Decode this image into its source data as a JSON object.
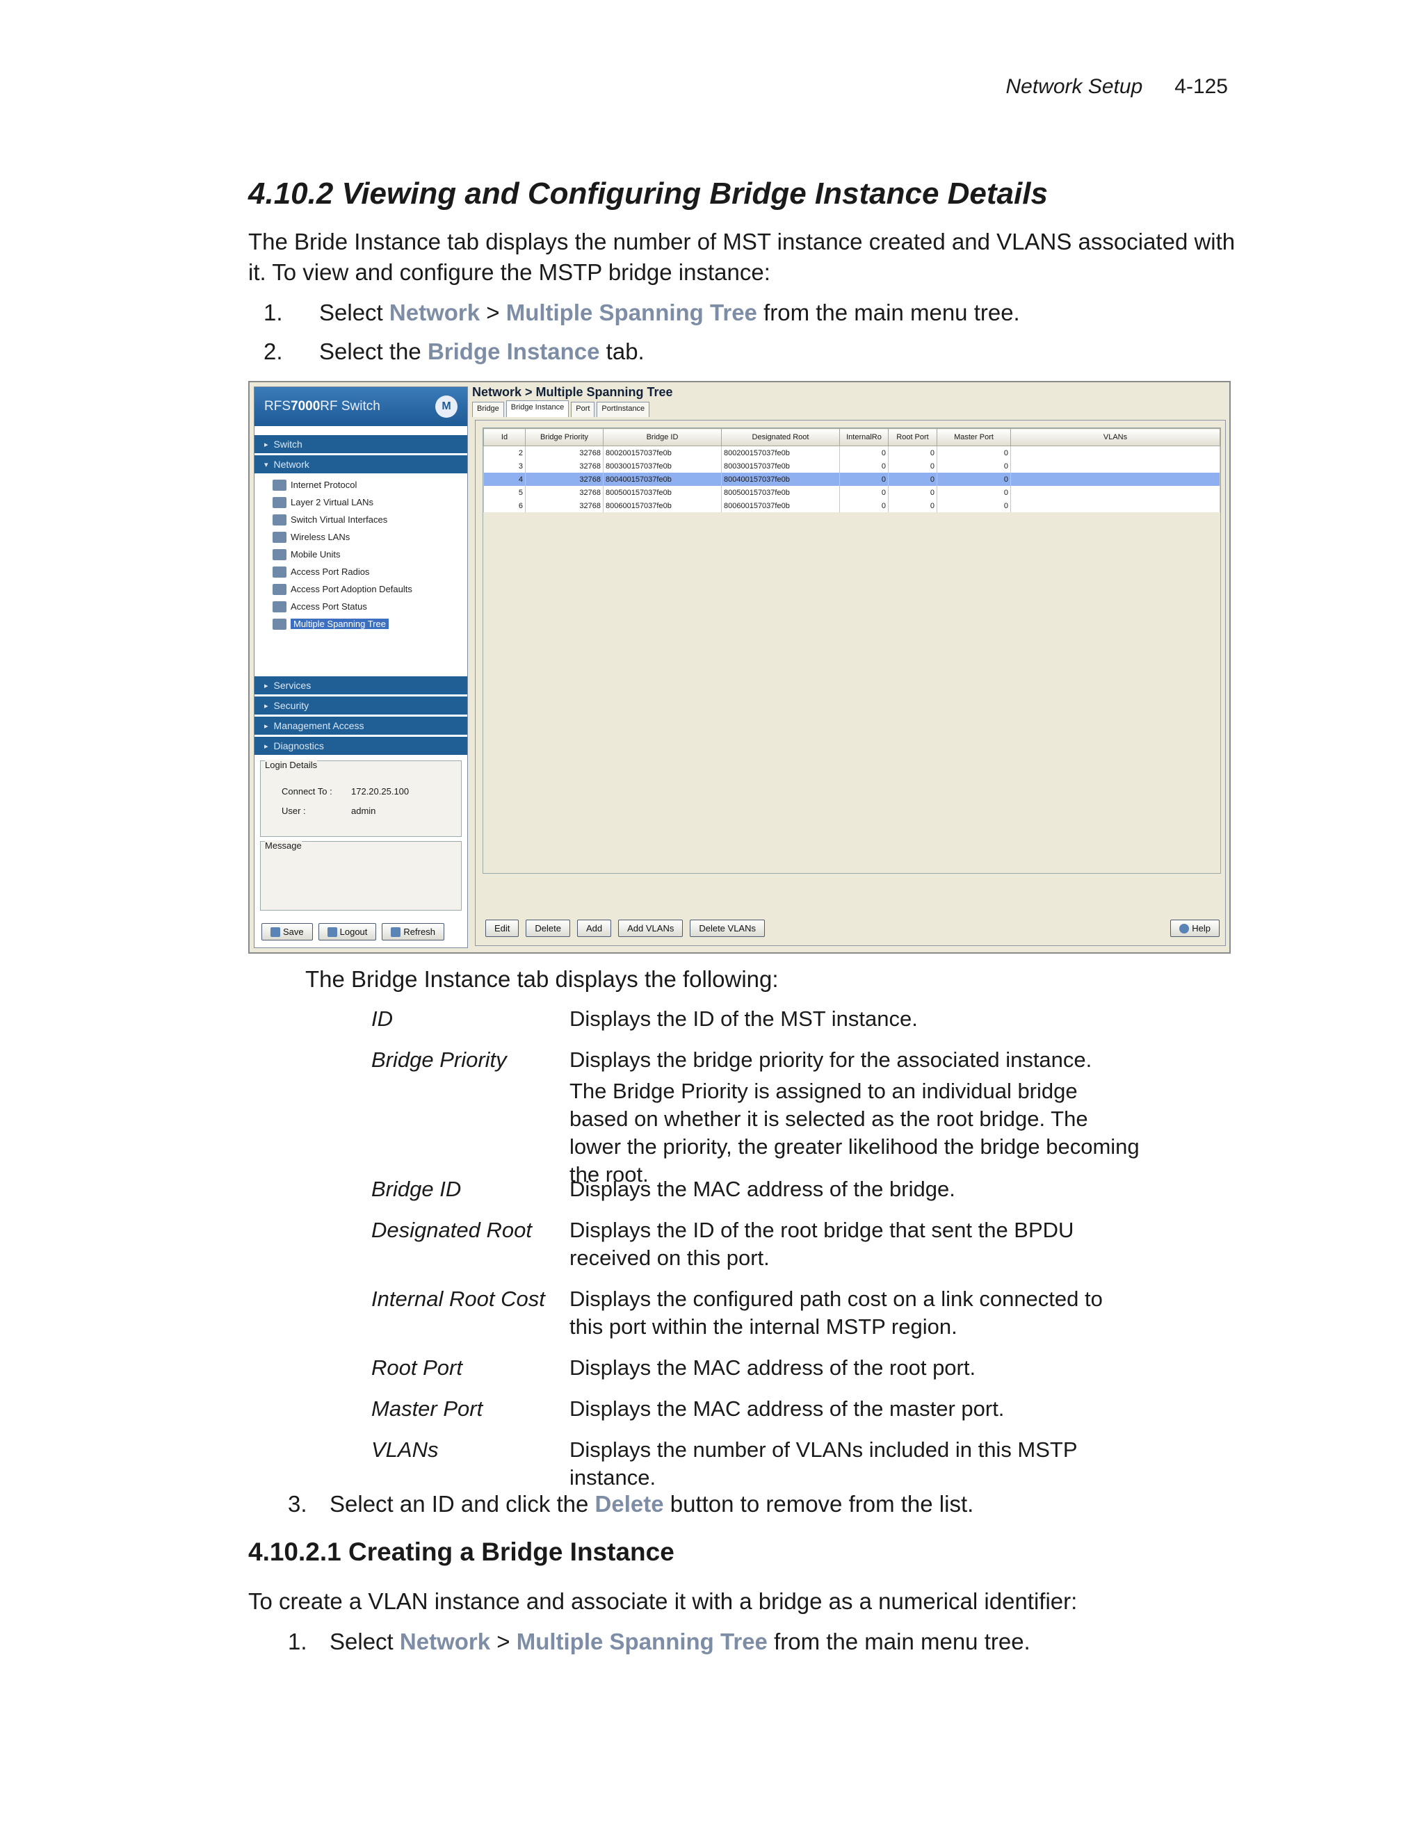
{
  "header": {
    "section": "Network Setup",
    "page": "4-125"
  },
  "title": "4.10.2 Viewing and Configuring Bridge Instance Details",
  "intro": "The Bride Instance tab displays the number of MST instance created and VLANS associated with it. To view and configure the MSTP bridge instance:",
  "steps_a": [
    {
      "num": "1.",
      "pre": "Select ",
      "k1": "Network",
      "mid": " > ",
      "k2": "Multiple Spanning Tree",
      "post": " from the main menu tree."
    },
    {
      "num": "2.",
      "pre": "Select the ",
      "k1": "Bridge Instance",
      "post": " tab."
    }
  ],
  "ui": {
    "brand_pre": "RFS",
    "brand_bold": "7000",
    "brand_post": " RF Switch",
    "logo": "M",
    "nav_top": [
      {
        "label": "Switch",
        "arrow": "▸"
      },
      {
        "label": "Network",
        "arrow": "▾"
      }
    ],
    "tree": [
      "Internet Protocol",
      "Layer 2 Virtual LANs",
      "Switch Virtual Interfaces",
      "Wireless LANs",
      "Mobile Units",
      "Access Port Radios",
      "Access Port Adoption Defaults",
      "Access Port Status",
      "Multiple Spanning Tree"
    ],
    "nav_bottom": [
      {
        "label": "Services",
        "arrow": "▸"
      },
      {
        "label": "Security",
        "arrow": "▸"
      },
      {
        "label": "Management Access",
        "arrow": "▸"
      },
      {
        "label": "Diagnostics",
        "arrow": "▸"
      }
    ],
    "login": {
      "caption": "Login Details",
      "connect_label": "Connect To :",
      "connect_value": "172.20.25.100",
      "user_label": "User :",
      "user_value": "admin"
    },
    "message_caption": "Message",
    "left_buttons": [
      "Save",
      "Logout",
      "Refresh"
    ],
    "right_title": "Network > Multiple Spanning Tree",
    "tabs": [
      "Bridge",
      "Bridge Instance",
      "Port",
      "PortInstance"
    ],
    "columns": [
      "Id",
      "Bridge Priority",
      "Bridge ID",
      "Designated Root",
      "InternalRo",
      "Root Port",
      "Master Port",
      "VLANs"
    ],
    "rows": [
      [
        "2",
        "32768",
        "800200157037fe0b",
        "800200157037fe0b",
        "0",
        "0",
        "0",
        ""
      ],
      [
        "3",
        "32768",
        "800300157037fe0b",
        "800300157037fe0b",
        "0",
        "0",
        "0",
        ""
      ],
      [
        "4",
        "32768",
        "800400157037fe0b",
        "800400157037fe0b",
        "0",
        "0",
        "0",
        ""
      ],
      [
        "5",
        "32768",
        "800500157037fe0b",
        "800500157037fe0b",
        "0",
        "0",
        "0",
        ""
      ],
      [
        "6",
        "32768",
        "800600157037fe0b",
        "800600157037fe0b",
        "0",
        "0",
        "0",
        ""
      ]
    ],
    "selected_row": 2,
    "bottom_buttons": [
      "Edit",
      "Delete",
      "Add",
      "Add VLANs",
      "Delete VLANs"
    ],
    "help": "Help"
  },
  "displays_intro": "The Bridge Instance tab displays the following:",
  "defs": [
    {
      "term": "ID",
      "def": [
        "Displays the ID of the MST instance."
      ]
    },
    {
      "term": "Bridge Priority",
      "def": [
        "Displays the bridge priority for the associated instance.",
        "The Bridge Priority is assigned to an individual bridge based on whether it is selected as the root bridge. The lower the priority, the greater likelihood the bridge becoming the root."
      ]
    },
    {
      "term": "Bridge ID",
      "def": [
        "Displays the MAC address of the bridge."
      ]
    },
    {
      "term": "Designated Root",
      "def": [
        "Displays the ID of the root bridge that sent the BPDU received on this port."
      ]
    },
    {
      "term": "Internal Root Cost",
      "def": [
        "Displays the configured path cost on a link connected to this port within the internal MSTP region."
      ]
    },
    {
      "term": "Root Port",
      "def": [
        "Displays the MAC address of the root port."
      ]
    },
    {
      "term": "Master Port",
      "def": [
        "Displays the MAC address of the master port."
      ]
    },
    {
      "term": "VLANs",
      "def": [
        "Displays the number of VLANs included in this MSTP instance."
      ]
    }
  ],
  "step3": {
    "num": "3.",
    "pre": "Select an ID and click the ",
    "k1": "Delete",
    "post": " button to remove from the list."
  },
  "subtitle": "4.10.2.1 Creating a Bridge Instance",
  "create_intro": "To create a VLAN instance and associate it with a bridge as a numerical identifier:",
  "step_b1": {
    "num": "1.",
    "pre": "Select ",
    "k1": "Network",
    "mid": " > ",
    "k2": "Multiple Spanning Tree",
    "post": " from the main menu tree."
  }
}
